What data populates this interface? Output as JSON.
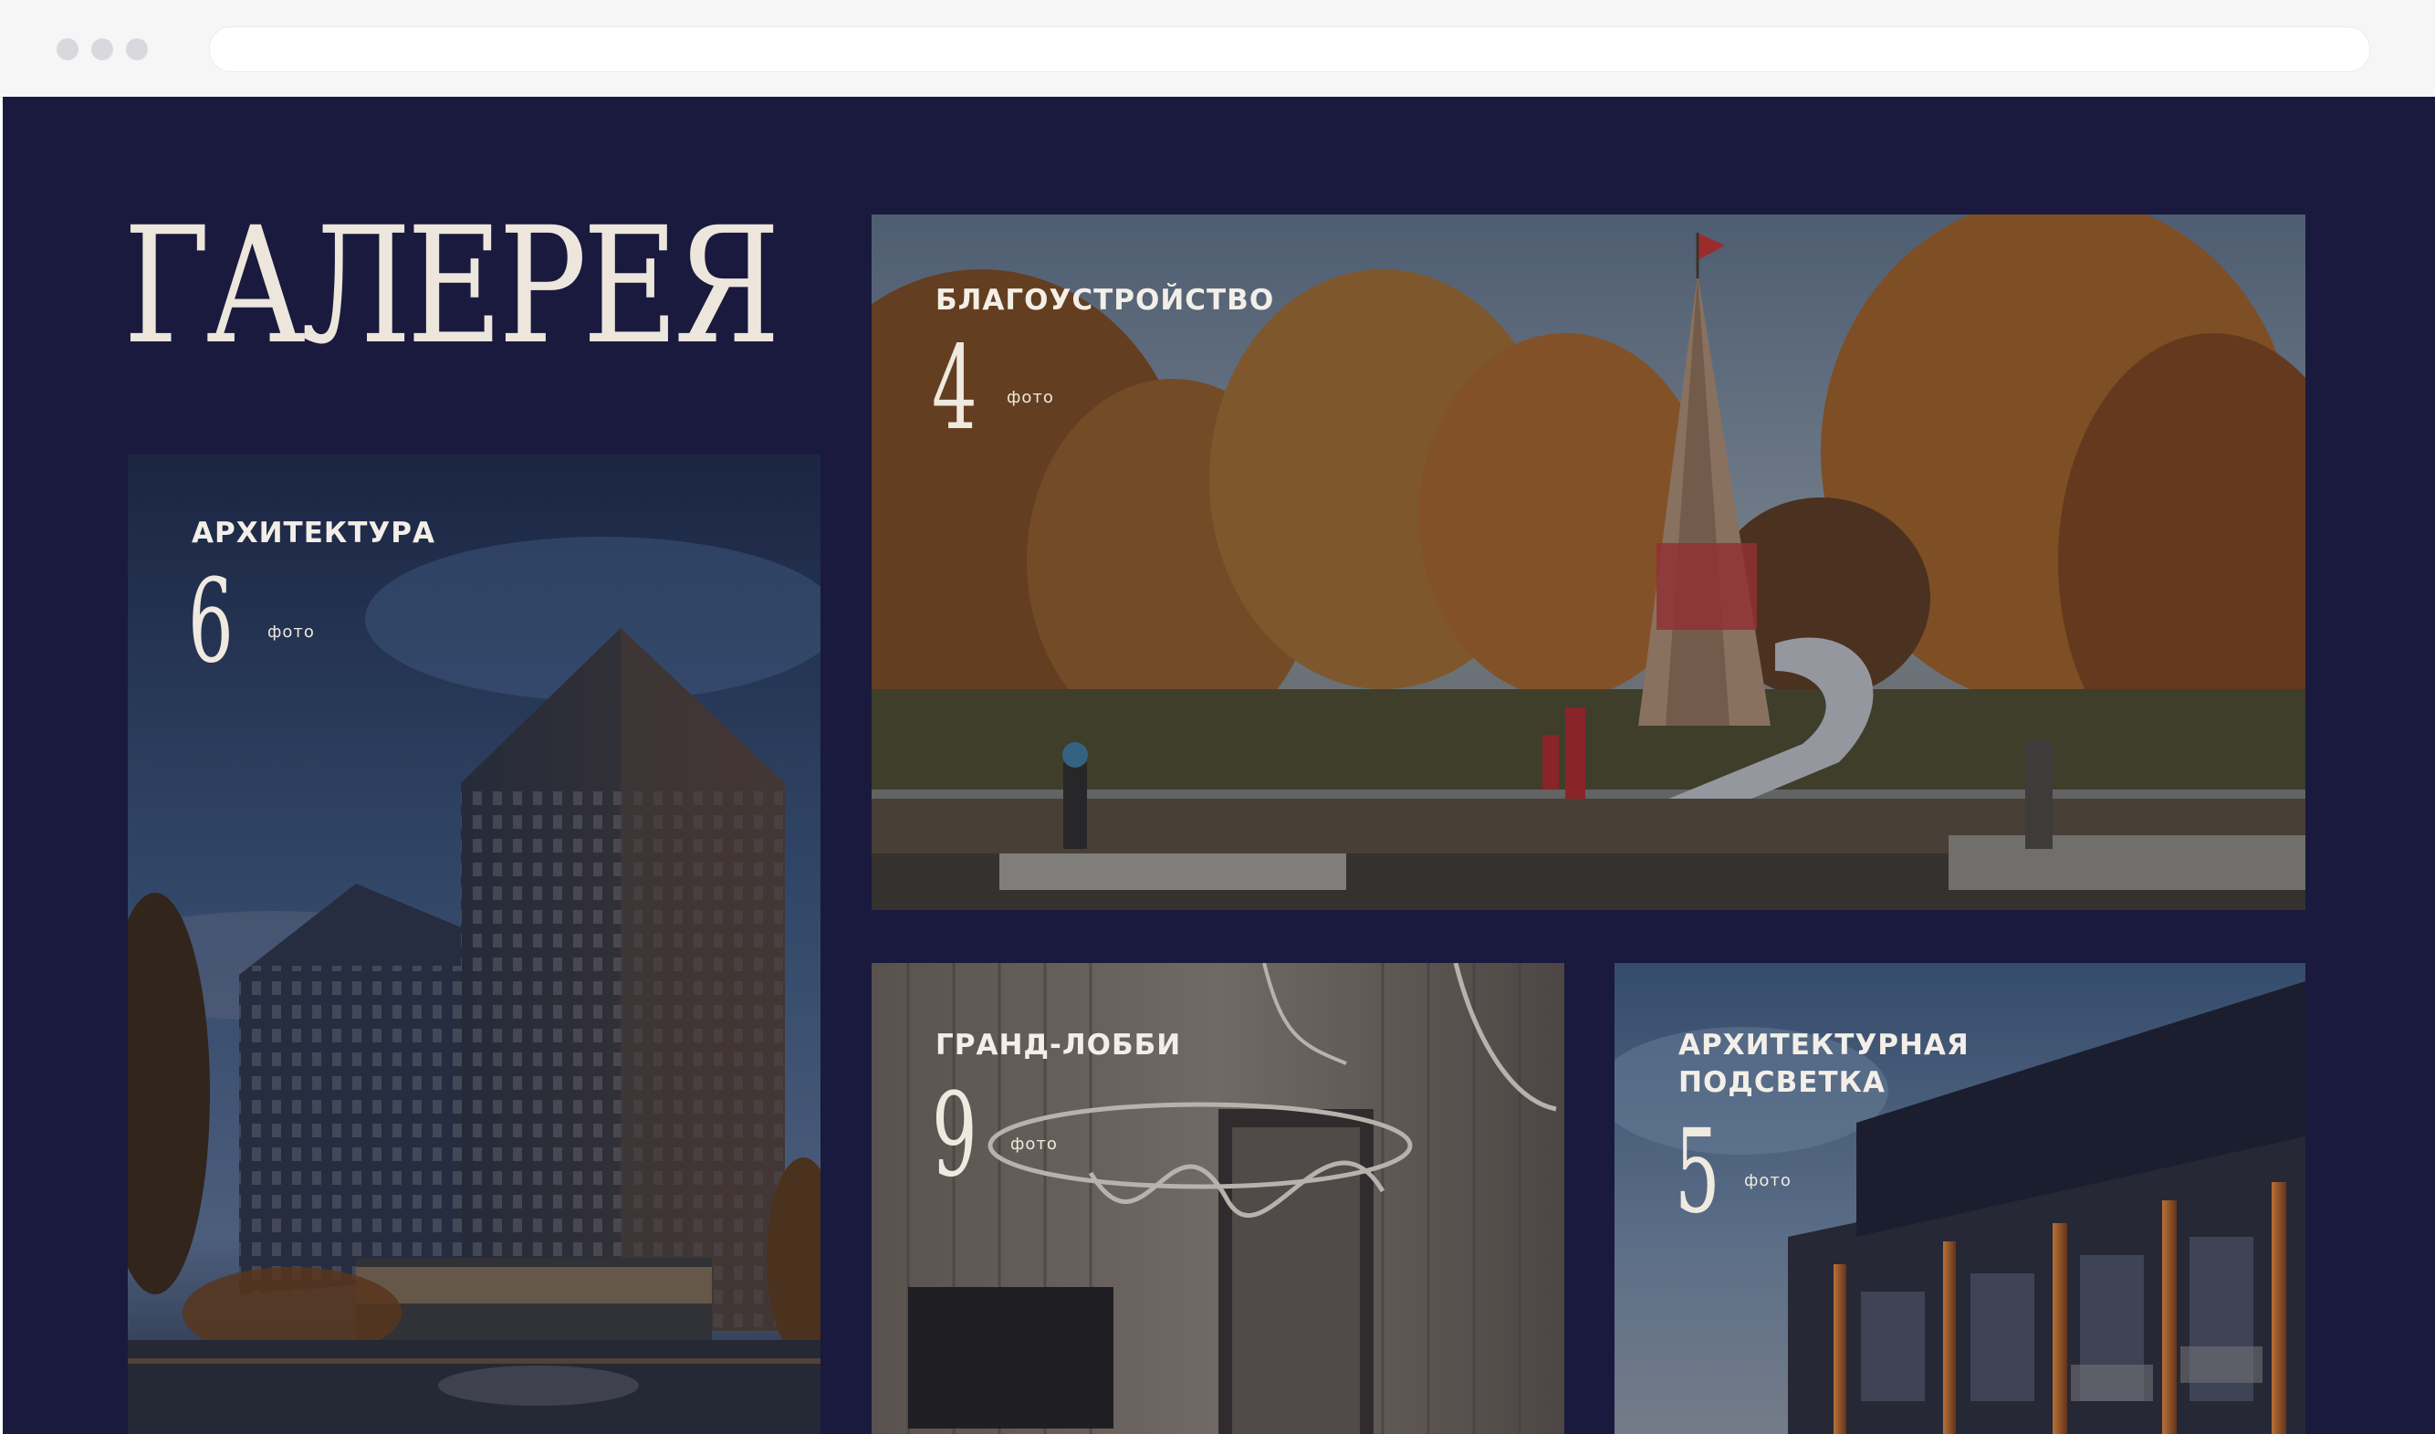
{
  "page": {
    "title": "ГАЛЕРЕЯ"
  },
  "gallery": {
    "items": [
      {
        "label": "АРХИТЕКТУРА",
        "count": "6",
        "unit": "фото"
      },
      {
        "label": "БЛАГОУСТРОЙСТВО",
        "count": "4",
        "unit": "фото"
      },
      {
        "label": "ГРАНД-ЛОББИ",
        "count": "9",
        "unit": "фото"
      },
      {
        "label": "АРХИТЕКТУРНАЯ ПОДСВЕТКА",
        "count": "5",
        "unit": "фото"
      }
    ]
  },
  "colors": {
    "page_background": "#191a3d",
    "text_light": "#efe9df"
  }
}
